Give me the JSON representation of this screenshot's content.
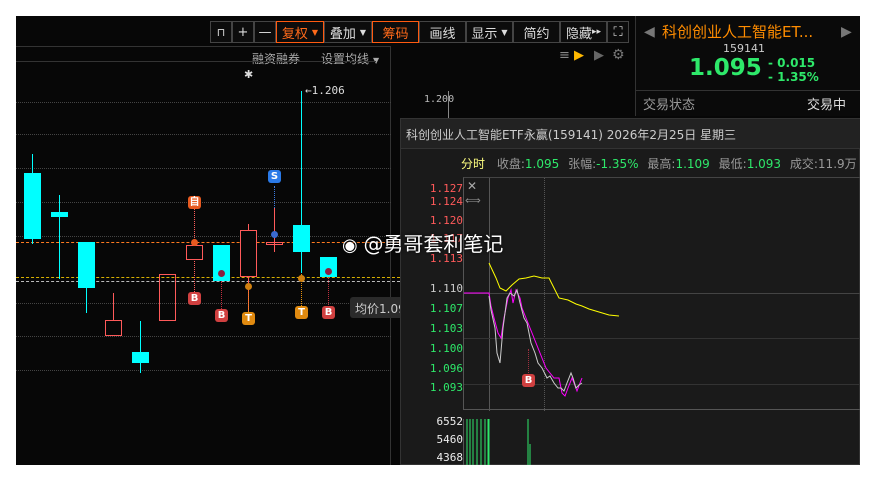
{
  "toolbar": {
    "lock": "🔓",
    "plus": "+",
    "minus": "—",
    "fuquan": "复权",
    "overlay": "叠加",
    "chips": "筹码",
    "draw": "画线",
    "display": "显示",
    "simple": "简约",
    "hide": "隐藏",
    "hide_icon": "▸▸",
    "fullscreen": "⛶"
  },
  "subbar": {
    "margin": "融资融券",
    "set_ma": "设置均线"
  },
  "chart": {
    "high_label": "←1.206",
    "avg_tooltip": "均价1.09",
    "axis_label": "1.200",
    "markers": {
      "zi": "自",
      "b": "B",
      "s": "S",
      "t": "T"
    }
  },
  "quote": {
    "name": "科创创业人工智能ET...",
    "code": "159141",
    "price": "1.095",
    "change": "- 0.015",
    "change_pct": "- 1.35%",
    "status_label": "交易状态",
    "status_value": "交易中"
  },
  "popup": {
    "title": "科创创业人工智能ETF永赢(159141) 2026年2月25日 星期三",
    "tab": "分时",
    "close_label": "收盘:",
    "close": "1.095",
    "chg_label": "张幅:",
    "chg": "-1.35%",
    "high_label": "最高:",
    "high": "1.109",
    "low_label": "最低:",
    "low": "1.093",
    "vol_label": "成交:",
    "vol": "11.9万",
    "price_ticks": [
      "1.127",
      "1.124",
      "1.120",
      "1.117",
      "1.113",
      "1.110",
      "1.107",
      "1.103",
      "1.100",
      "1.096",
      "1.093"
    ],
    "vol_ticks": [
      "6552",
      "5460",
      "4368"
    ],
    "marker": "B"
  },
  "watermark": "@勇哥套利笔记",
  "colors": {
    "up": "#ff5a5a",
    "down": "#00ffff",
    "accent": "#ff6a1a",
    "green": "#2ee86a"
  }
}
